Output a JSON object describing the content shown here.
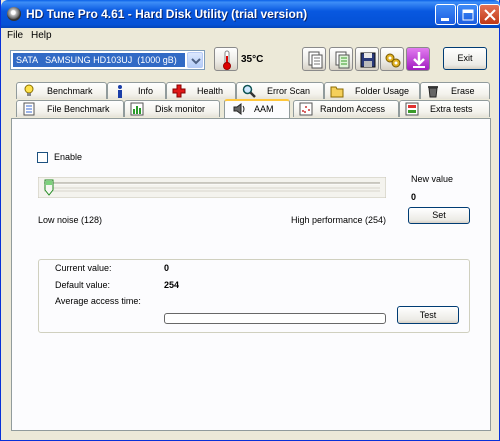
{
  "window": {
    "title": "HD Tune Pro 4.61 - Hard Disk Utility (trial version)"
  },
  "menu": [
    "File",
    "Help"
  ],
  "toolbar": {
    "drive": "SATA   SAMSUNG HD103UJ  (1000 gB)",
    "temperature": "35°C",
    "exit_label": "Exit"
  },
  "tabs_row1": [
    "Benchmark",
    "Info",
    "Health",
    "Error Scan",
    "Folder Usage",
    "Erase"
  ],
  "tabs_row2": [
    "File Benchmark",
    "Disk monitor",
    "AAM",
    "Random Access",
    "Extra tests"
  ],
  "active_tab": "AAM",
  "aam": {
    "enable_label": "Enable",
    "enabled": false,
    "new_value_label": "New value",
    "new_value": "0",
    "slider_position": 0,
    "low_label": "Low noise (128)",
    "high_label": "High performance (254)",
    "set_label": "Set",
    "current_label": "Current value:",
    "current_value": "0",
    "default_label": "Default value:",
    "default_value": "254",
    "access_label": "Average access time:",
    "test_label": "Test",
    "progress": 0
  },
  "colors": {
    "titlebar": "#0858e0",
    "close_button": "#c03816",
    "active_tab_highlight": "#ffc73c"
  },
  "icons": [
    "app-icon",
    "minimize-icon",
    "maximize-icon",
    "close-icon",
    "thermometer-icon",
    "copy-icon",
    "copy-all-icon",
    "save-icon",
    "options-icon",
    "download-icon"
  ]
}
